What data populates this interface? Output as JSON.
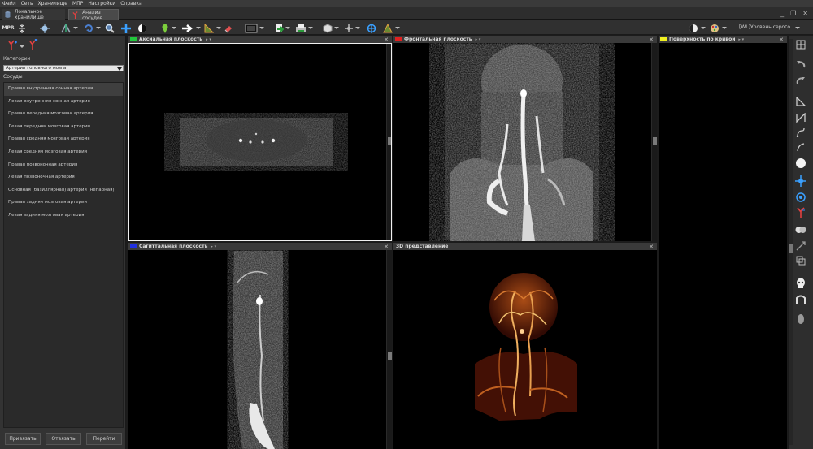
{
  "menu": [
    "Файл",
    "Сеть",
    "Хранилище",
    "МПР",
    "Настройки",
    "Справка"
  ],
  "tabs": [
    {
      "label": "Локальное хранилище",
      "icon": "database-icon"
    },
    {
      "label": "Анализ сосудов",
      "icon": "vessel-icon"
    }
  ],
  "toolbar": {
    "mpr_label": "MPR",
    "wl_label": "[WL]Уровень серого"
  },
  "left_panel": {
    "category_label": "Категории",
    "category_value": "Артерии головного мозга",
    "vessels_label": "Сосуды",
    "vessels": [
      "Правая внутренняя сонная артерия",
      "Левая внутренняя сонная артерия",
      "Правая передняя мозговая артерия",
      "Левая передняя мозговая артерия",
      "Правая средняя мозговая артерия",
      "Левая средняя мозговая артерия",
      "Правая позвоночная артерия",
      "Левая позвоночная артерия",
      "Основная (базиллярная) артерия (непарная)",
      "Правая задняя мозговая артерия",
      "Левая задняя мозговая артерия"
    ],
    "buttons": {
      "bind": "Привязать",
      "unbind": "Отвязать",
      "goto": "Перейти"
    }
  },
  "viewports": {
    "axial": {
      "title": "Аксиальная плоскость",
      "color": "#22c83c"
    },
    "frontal": {
      "title": "Фронтальная плоскость",
      "color": "#e02020"
    },
    "curve": {
      "title": "Поверхность по кривой",
      "color": "#f0f020"
    },
    "sagittal": {
      "title": "Сагиттальная плоскость",
      "color": "#2030e0"
    },
    "volume": {
      "title": "3D представление"
    }
  }
}
